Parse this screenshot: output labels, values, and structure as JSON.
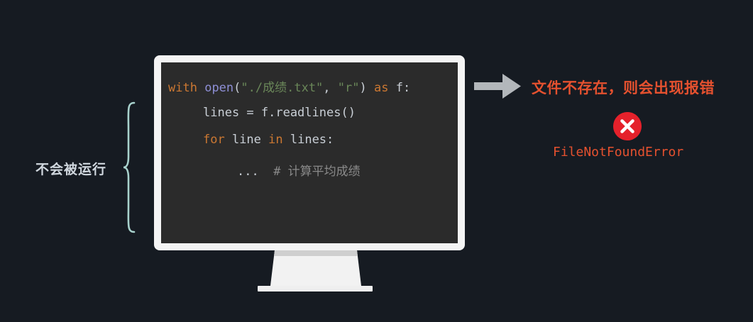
{
  "side_label": "不会被运行",
  "code": {
    "line1": {
      "kw_with": "with",
      "fn_open": "open",
      "p_open": "(",
      "str_path": "\"./成绩.txt\"",
      "comma": ", ",
      "str_mode": "\"r\"",
      "p_close": ")",
      "kw_as": "as",
      "var": "f:"
    },
    "line2": "lines = f.readlines()",
    "line3": {
      "kw_for": "for",
      "mid": " line ",
      "kw_in": "in",
      "rest": " lines:"
    },
    "line4": {
      "ellipsis": "...",
      "comment": "# 计算平均成绩"
    }
  },
  "result_text": "文件不存在，则会出现报错",
  "error_name": "FileNotFoundError",
  "icons": [
    "right-arrow-icon",
    "error-x-icon"
  ],
  "colors": {
    "keyword": "#cc7832",
    "function": "#8e8fd6",
    "string": "#6a8759",
    "error": "#e5512f"
  }
}
